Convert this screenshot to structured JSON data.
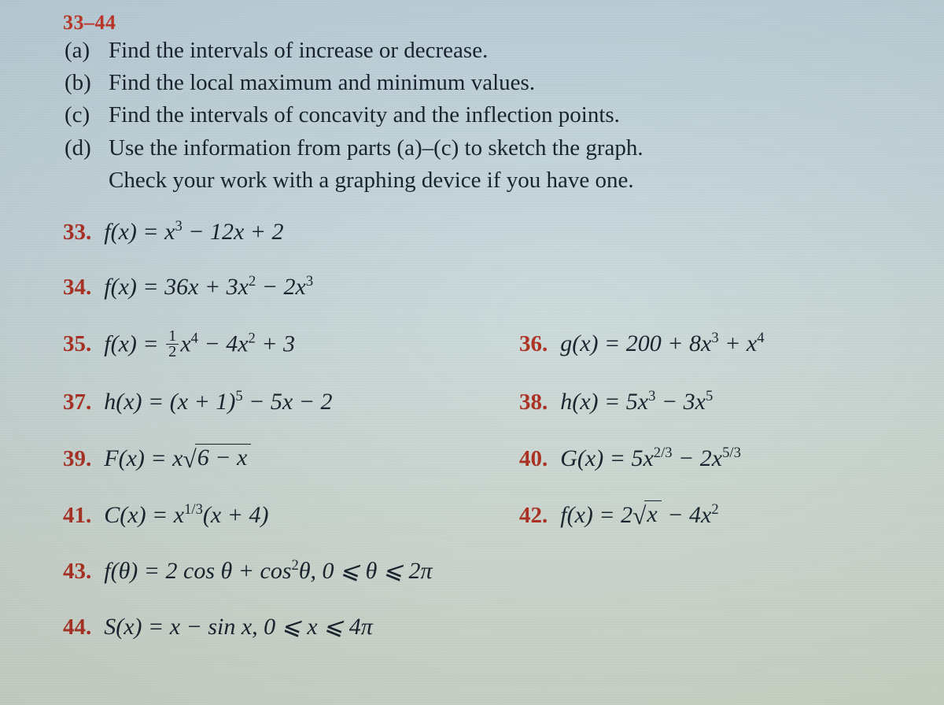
{
  "range": "33–44",
  "instructions": {
    "a_label": "(a)",
    "a_text": "Find the intervals of increase or decrease.",
    "b_label": "(b)",
    "b_text": "Find the local maximum and minimum values.",
    "c_label": "(c)",
    "c_text": "Find the intervals of concavity and the inflection points.",
    "d_label": "(d)",
    "d_text": "Use the information from parts (a)–(c) to sketch the graph.",
    "d_text2": "Check your work with a graphing device if you have one."
  },
  "p33": {
    "num": "33.",
    "lhs": "f(x) = ",
    "rest": " − 12x + 2"
  },
  "p34": {
    "num": "34.",
    "lhs": "f(x) = 36x + 3x",
    "mid": " − 2x"
  },
  "p35": {
    "num": "35.",
    "lhs": "f(x) = ",
    "rest": " − 4x",
    "tail": " + 3"
  },
  "p36": {
    "num": "36.",
    "lhs": "g(x) = 200 + 8x",
    "mid": " + x"
  },
  "p37": {
    "num": "37.",
    "lhs": "h(x) = (x + 1)",
    "rest": " − 5x − 2"
  },
  "p38": {
    "num": "38.",
    "lhs": "h(x) = 5x",
    "mid": " − 3x"
  },
  "p39": {
    "num": "39.",
    "lhs": "F(x) = x",
    "rad": "6 − x"
  },
  "p40": {
    "num": "40.",
    "lhs": "G(x) = 5x",
    "mid": " − 2x"
  },
  "p41": {
    "num": "41.",
    "lhs": "C(x) = x",
    "rest": "(x + 4)"
  },
  "p42": {
    "num": "42.",
    "lhs": "f(x) = 2",
    "rad": "x",
    "tail": " − 4x"
  },
  "p43": {
    "num": "43.",
    "lhs": "f(θ) = 2 cos θ + cos",
    "tail": "θ,   0 ⩽ θ ⩽ 2π"
  },
  "p44": {
    "num": "44.",
    "lhs": "S(x) = x − sin x,   0 ⩽ x ⩽ 4π"
  },
  "sup": {
    "s2": "2",
    "s3": "3",
    "s4": "4",
    "s5": "5",
    "s23": "2/3",
    "s53": "5/3",
    "s13": "1/3"
  },
  "frac": {
    "half_n": "1",
    "half_d": "2"
  },
  "chart_data": {
    "type": "table",
    "title": "Calculus textbook exercises 33–44: curve sketching problems",
    "tasks": [
      "(a) Find the intervals of increase or decrease.",
      "(b) Find the local maximum and minimum values.",
      "(c) Find the intervals of concavity and the inflection points.",
      "(d) Use the information from parts (a)–(c) to sketch the graph. Check your work with a graphing device if you have one."
    ],
    "problems": [
      {
        "n": 33,
        "fn": "f(x) = x^3 − 12x + 2"
      },
      {
        "n": 34,
        "fn": "f(x) = 36x + 3x^2 − 2x^3"
      },
      {
        "n": 35,
        "fn": "f(x) = (1/2)x^4 − 4x^2 + 3"
      },
      {
        "n": 36,
        "fn": "g(x) = 200 + 8x^3 + x^4"
      },
      {
        "n": 37,
        "fn": "h(x) = (x + 1)^5 − 5x − 2"
      },
      {
        "n": 38,
        "fn": "h(x) = 5x^3 − 3x^5"
      },
      {
        "n": 39,
        "fn": "F(x) = x√(6 − x)"
      },
      {
        "n": 40,
        "fn": "G(x) = 5x^(2/3) − 2x^(5/3)"
      },
      {
        "n": 41,
        "fn": "C(x) = x^(1/3)(x + 4)"
      },
      {
        "n": 42,
        "fn": "f(x) = 2√x − 4x^2"
      },
      {
        "n": 43,
        "fn": "f(θ) = 2 cos θ + cos^2 θ,  0 ⩽ θ ⩽ 2π"
      },
      {
        "n": 44,
        "fn": "S(x) = x − sin x,  0 ⩽ x ⩽ 4π"
      }
    ]
  }
}
